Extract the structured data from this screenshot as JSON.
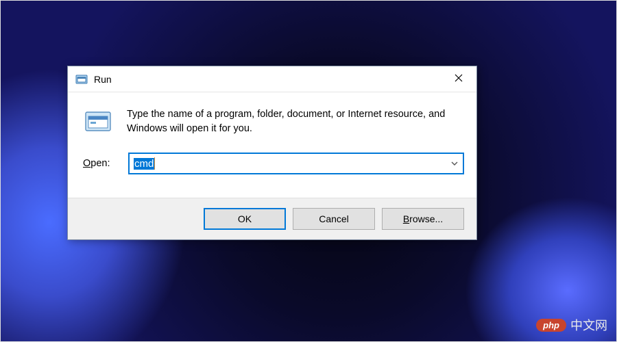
{
  "dialog": {
    "title": "Run",
    "help_text": "Type the name of a program, folder, document, or Internet resource, and Windows will open it for you.",
    "open_label": "Open:",
    "open_accel": "O",
    "input_value": "cmd",
    "buttons": {
      "ok": "OK",
      "cancel": "Cancel",
      "browse": "Browse...",
      "browse_accel": "B"
    }
  },
  "watermark": {
    "badge": "php",
    "text": "中文网"
  }
}
